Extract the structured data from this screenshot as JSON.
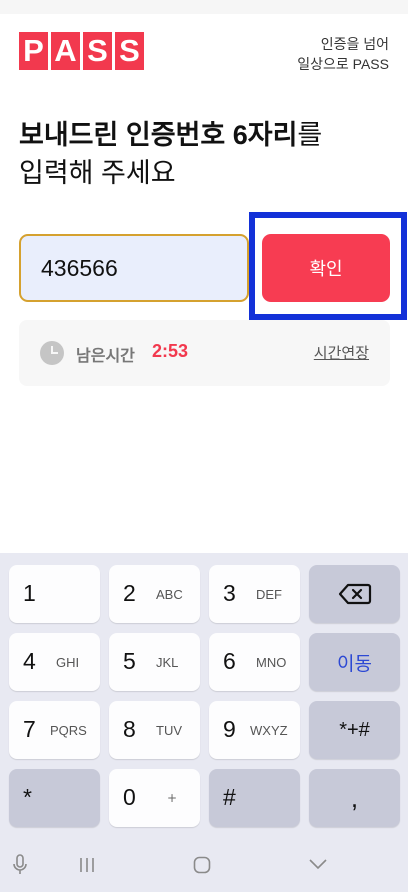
{
  "brand": {
    "letters": [
      "P",
      "A",
      "S",
      "S"
    ],
    "color": "#f2394e"
  },
  "tagline": {
    "line1": "인증을 넘어",
    "line2": "일상으로 PASS"
  },
  "headline": {
    "line1_strong": "보내드린 인증번호 6자리",
    "line1_rest": "를",
    "line2": "입력해 주세요"
  },
  "code_input": {
    "value": "436566"
  },
  "confirm_button": {
    "label": "확인"
  },
  "timer": {
    "label": "남은시간",
    "value": "2:53",
    "extend_label": "시간연장"
  },
  "keyboard": {
    "keys": [
      {
        "num": "1",
        "sub": ""
      },
      {
        "num": "2",
        "sub": "ABC"
      },
      {
        "num": "3",
        "sub": "DEF"
      },
      {
        "num": "4",
        "sub": "GHI"
      },
      {
        "num": "5",
        "sub": "JKL"
      },
      {
        "num": "6",
        "sub": "MNO"
      },
      {
        "num": "7",
        "sub": "PQRS"
      },
      {
        "num": "8",
        "sub": "TUV"
      },
      {
        "num": "9",
        "sub": "WXYZ"
      },
      {
        "num": "0",
        "sub": "+"
      }
    ],
    "move_label": "이동",
    "symbols_label": "*+#",
    "asterisk_label": "*",
    "hash_label": "#",
    "comma_label": ",",
    "backspace_icon": "backspace-icon"
  },
  "navbar": {
    "icons": [
      "mic-icon",
      "recent-apps-icon",
      "home-icon",
      "back-icon"
    ]
  },
  "colors": {
    "accent": "#f73c52",
    "highlight_border": "#1331d8",
    "input_border": "#d5a12f",
    "input_bg": "#e9eefc",
    "link_blue": "#2d49d4"
  }
}
